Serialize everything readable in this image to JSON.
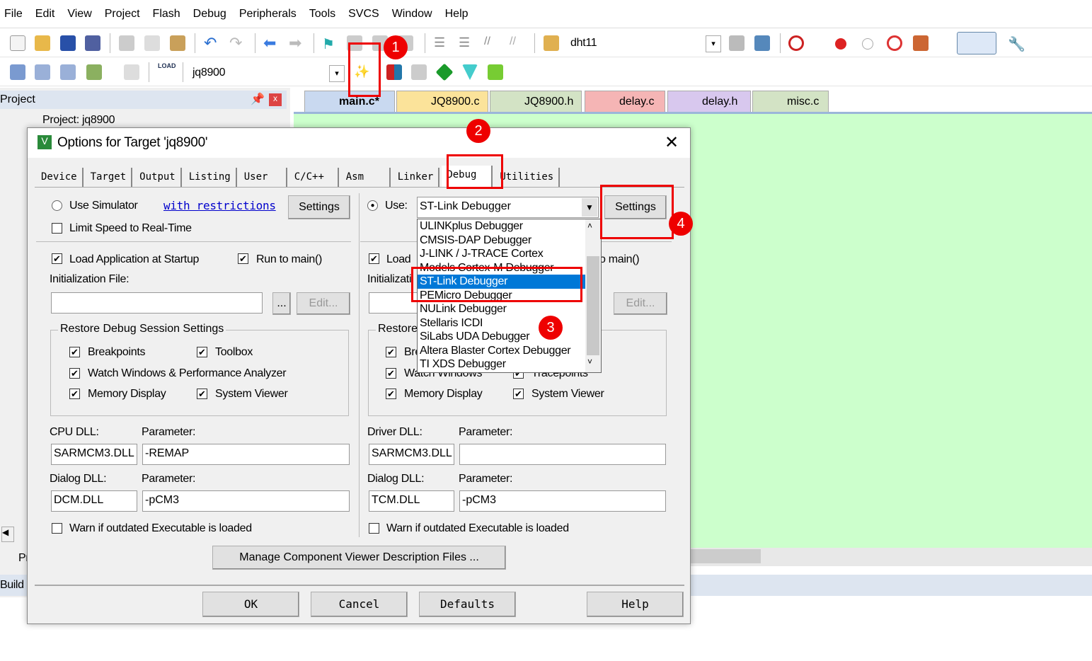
{
  "menu": [
    "File",
    "Edit",
    "View",
    "Project",
    "Flash",
    "Debug",
    "Peripherals",
    "Tools",
    "SVCS",
    "Window",
    "Help"
  ],
  "toolbar": {
    "find_value": "dht11",
    "target_value": "jq8900",
    "load_label": "LOAD"
  },
  "project_panel": {
    "title": "Project",
    "tree_root": "Project: jq8900",
    "bottom_tab": "Pr",
    "build_label": "Build"
  },
  "file_tabs": [
    {
      "label": "main.c*",
      "color": "#c9d9f0"
    },
    {
      "label": "JQ8900.c",
      "color": "#fbe39a"
    },
    {
      "label": "JQ8900.h",
      "color": "#d3e3c5"
    },
    {
      "label": "delay.c",
      "color": "#f5b5b5"
    },
    {
      "label": "delay.h",
      "color": "#d8c8ee"
    },
    {
      "label": "misc.c",
      "color": "#d3e3c5"
    }
  ],
  "editor_bg": "#ccffcc",
  "annotations": [
    "1",
    "2",
    "3",
    "4"
  ],
  "dialog": {
    "title": "Options for Target 'jq8900'",
    "tabs": [
      "Device",
      "Target",
      "Output",
      "Listing",
      "User",
      "C/C++",
      "Asm",
      "Linker",
      "Debug",
      "Utilities"
    ],
    "active_tab": "Debug",
    "left": {
      "use_simulator": "Use Simulator",
      "restrictions_link": "with restrictions",
      "settings": "Settings",
      "limit_speed": "Limit Speed to Real-Time",
      "load_app": "Load Application at Startup",
      "run_main": "Run to main()",
      "init_file": "Initialization File:",
      "browse": "...",
      "edit": "Edit...",
      "restore_group": "Restore Debug Session Settings",
      "breakpoints": "Breakpoints",
      "toolbox": "Toolbox",
      "watch": "Watch Windows & Performance Analyzer",
      "memory": "Memory Display",
      "system_viewer": "System Viewer",
      "cpu_dll": "CPU DLL:",
      "parameter": "Parameter:",
      "cpu_dll_value": "SARMCM3.DLL",
      "cpu_param_value": "-REMAP",
      "dialog_dll": "Dialog DLL:",
      "dialog_dll_value": "DCM.DLL",
      "dialog_param_value": "-pCM3",
      "warn": "Warn if outdated Executable is loaded"
    },
    "right": {
      "use": "Use:",
      "selected_debugger": "ST-Link Debugger",
      "settings": "Settings",
      "load": "Load",
      "run_main": "o main()",
      "init": "Initializati",
      "edit": "Edit...",
      "restore": "Restore",
      "bre": "Bre",
      "watch": "Watch Windows",
      "tracepoints": "Tracepoints",
      "memory": "Memory Display",
      "system_viewer": "System Viewer",
      "driver_dll": "Driver DLL:",
      "parameter": "Parameter:",
      "driver_dll_value": "SARMCM3.DLL",
      "driver_param_value": "",
      "dialog_dll": "Dialog DLL:",
      "dialog_dll_value": "TCM.DLL",
      "dialog_param_value": "-pCM3",
      "warn": "Warn if outdated Executable is loaded"
    },
    "debugger_options": [
      "ULINKplus Debugger",
      "CMSIS-DAP Debugger",
      "J-LINK / J-TRACE Cortex",
      "Models Cortex-M Debugger",
      "ST-Link Debugger",
      "PEMicro Debugger",
      "NULink Debugger",
      "Stellaris ICDI",
      "SiLabs UDA Debugger",
      "Altera Blaster Cortex Debugger",
      "TI XDS Debugger"
    ],
    "manage_button": "Manage Component Viewer Description Files ...",
    "buttons": {
      "ok": "OK",
      "cancel": "Cancel",
      "defaults": "Defaults",
      "help": "Help"
    }
  }
}
